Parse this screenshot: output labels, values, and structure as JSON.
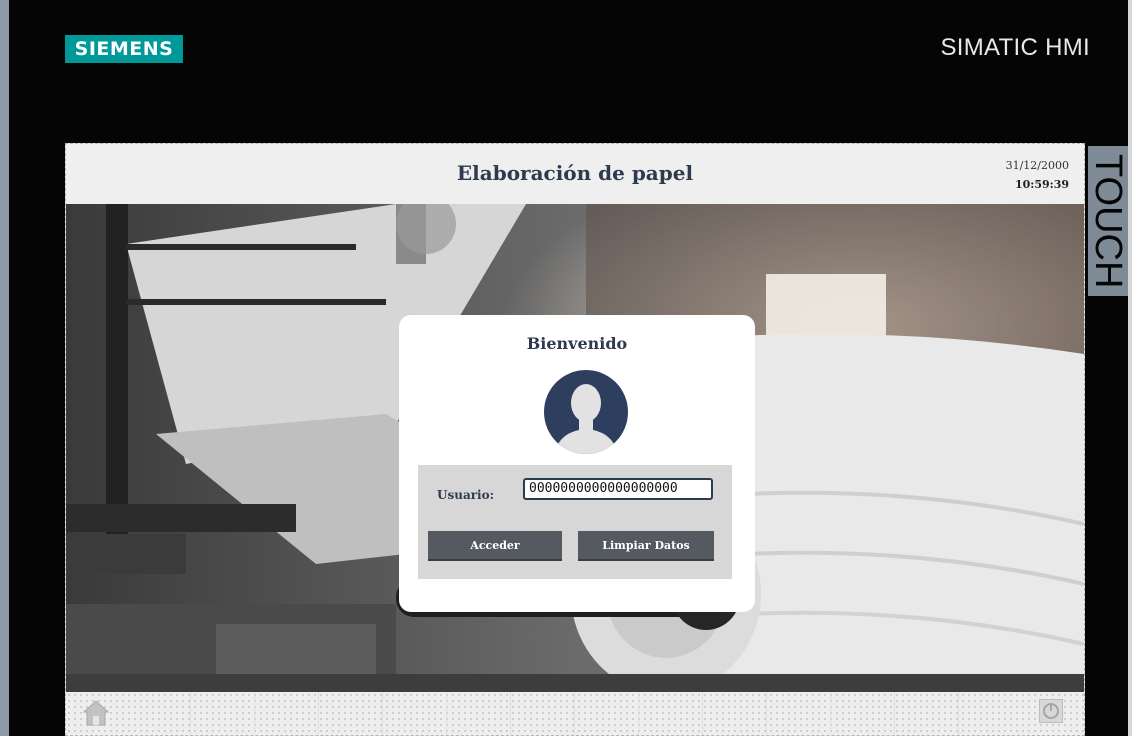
{
  "device": {
    "brand_logo": "SIEMENS",
    "product_title": "SIMATIC HMI",
    "model_label": "TOUCH"
  },
  "screen": {
    "title": "Elaboración de papel",
    "date": "31/12/2000",
    "time": "10:59:39"
  },
  "login": {
    "welcome": "Bienvenido",
    "user_label": "Usuario:",
    "user_value": "0000000000000000000",
    "button_access": "Acceder",
    "button_clear": "Limpiar Datos"
  },
  "footer": {
    "left_icon": "home-icon",
    "right_icon": "power-icon"
  },
  "colors": {
    "siemens_brand": "#009999",
    "title_text": "#2e3a4d",
    "button_bg": "#555a60"
  }
}
